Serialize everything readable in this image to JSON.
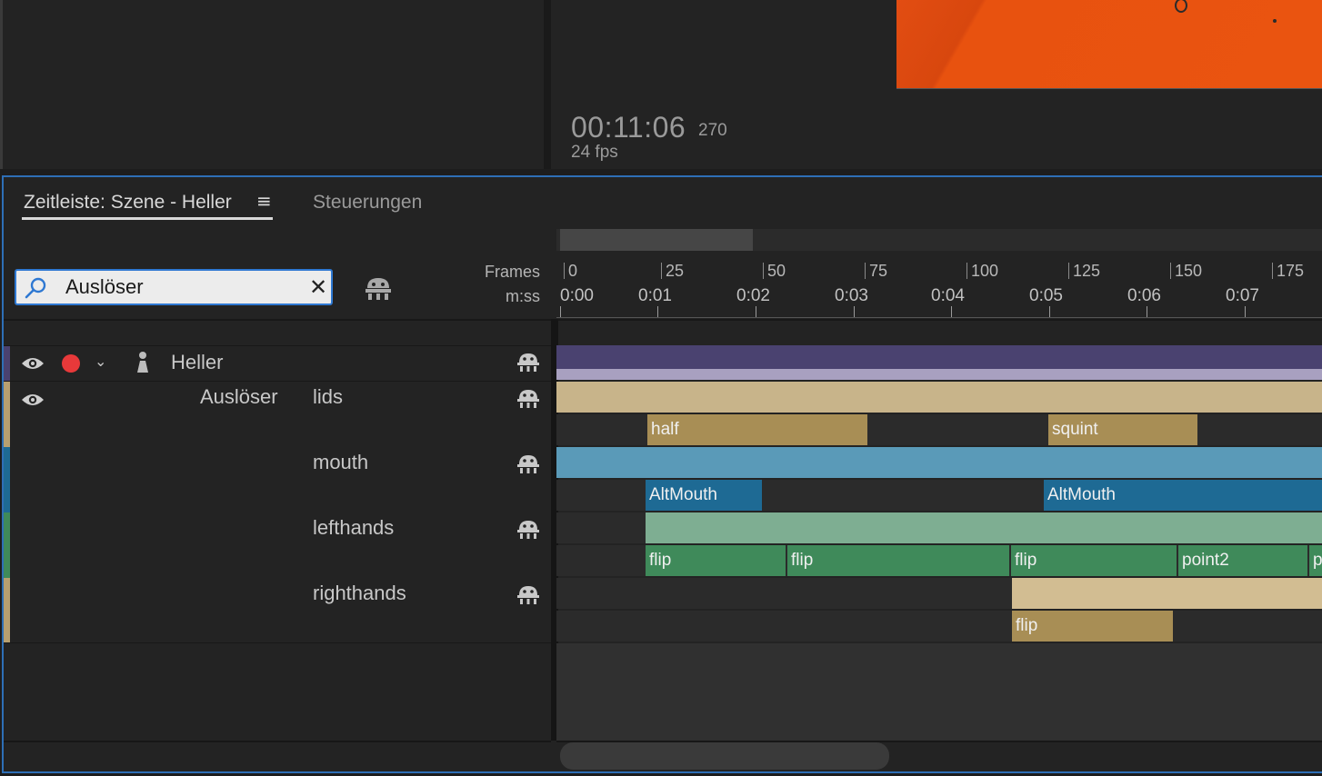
{
  "monitor": {
    "timecode": "00:11:06",
    "frame": "270",
    "fps": "24 fps"
  },
  "tabs": {
    "timeline": "Zeitleiste: Szene - Heller",
    "menu_icon": "≡",
    "controls": "Steuerungen"
  },
  "search": {
    "value": "Auslöser",
    "clear": "✕"
  },
  "ruler": {
    "frames_label": "Frames",
    "time_label": "m:ss",
    "frames": [
      "0",
      "25",
      "50",
      "75",
      "100",
      "125",
      "150",
      "175"
    ],
    "times": [
      "0:00",
      "0:01",
      "0:02",
      "0:03",
      "0:04",
      "0:05",
      "0:06",
      "0:07"
    ]
  },
  "tracks": {
    "puppet": "Heller",
    "group": "Auslöser",
    "triggers": [
      {
        "name": "lids",
        "color": "#c8b48a",
        "block_color": "#a88e55",
        "blocks": [
          "half",
          "squint"
        ]
      },
      {
        "name": "mouth",
        "color": "#5a9ab8",
        "block_color": "#1e6a94",
        "blocks": [
          "AltMouth",
          "AltMouth"
        ]
      },
      {
        "name": "lefthands",
        "color": "#7eae92",
        "block_color": "#3f8a5a",
        "blocks": [
          "flip",
          "flip",
          "flip",
          "point2",
          "po"
        ]
      },
      {
        "name": "righthands",
        "color": "#d2bd92",
        "block_color": "#a88e55",
        "blocks": [
          "flip"
        ]
      }
    ]
  },
  "colors": {
    "accent": "#2e6fb6",
    "puppet_bar": "#4a4270",
    "puppet_bar_light": "#a8a0c0",
    "record": "#e8393a"
  }
}
